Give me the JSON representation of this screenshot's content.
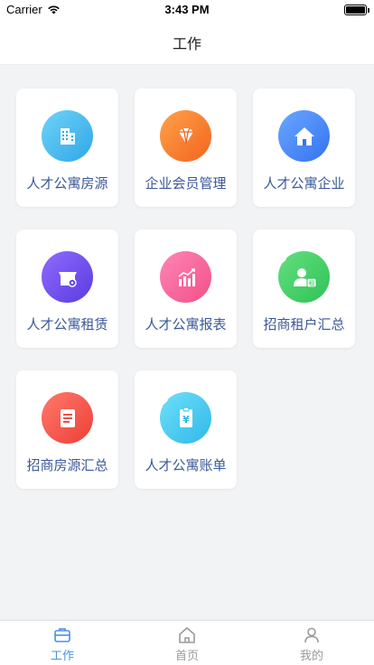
{
  "status_bar": {
    "carrier": "Carrier",
    "time": "3:43 PM"
  },
  "nav": {
    "title": "工作"
  },
  "cards": [
    {
      "label": "人才公寓房源",
      "icon": "building-icon",
      "gradient": [
        "#6fd3f7",
        "#2fa7e8"
      ]
    },
    {
      "label": "企业会员管理",
      "icon": "diamond-icon",
      "gradient": [
        "#ffa24a",
        "#f2641f"
      ]
    },
    {
      "label": "人才公寓企业",
      "icon": "house-icon",
      "gradient": [
        "#6ba7ff",
        "#3472f0"
      ]
    },
    {
      "label": "人才公寓租赁",
      "icon": "storefront-icon",
      "gradient": [
        "#8f6bff",
        "#5a3be0"
      ]
    },
    {
      "label": "人才公寓报表",
      "icon": "bar-chart-icon",
      "gradient": [
        "#ff86b7",
        "#f24f87"
      ]
    },
    {
      "label": "招商租户汇总",
      "icon": "tenant-icon",
      "gradient": [
        "#63e07f",
        "#2fc256"
      ]
    },
    {
      "label": "招商房源汇总",
      "icon": "document-icon",
      "gradient": [
        "#ff7a6b",
        "#ee3e37"
      ]
    },
    {
      "label": "人才公寓账单",
      "icon": "bill-icon",
      "gradient": [
        "#6fe0f8",
        "#2fb8ea"
      ]
    }
  ],
  "tabs": [
    {
      "label": "工作",
      "icon": "briefcase-icon",
      "active": true
    },
    {
      "label": "首页",
      "icon": "home-icon",
      "active": false
    },
    {
      "label": "我的",
      "icon": "person-icon",
      "active": false
    }
  ],
  "colors": {
    "accent": "#4a90e2",
    "label": "#3b5998",
    "background": "#f2f3f5"
  }
}
